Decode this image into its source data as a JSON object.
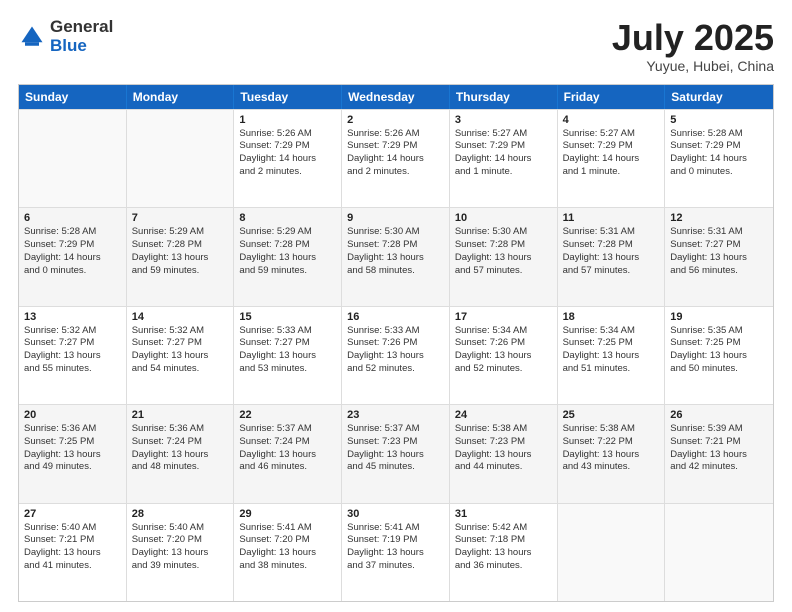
{
  "header": {
    "logo_general": "General",
    "logo_blue": "Blue",
    "month_title": "July 2025",
    "location": "Yuyue, Hubei, China"
  },
  "days_of_week": [
    "Sunday",
    "Monday",
    "Tuesday",
    "Wednesday",
    "Thursday",
    "Friday",
    "Saturday"
  ],
  "weeks": [
    [
      {
        "day": "",
        "info": [],
        "empty": true
      },
      {
        "day": "",
        "info": [],
        "empty": true
      },
      {
        "day": "1",
        "info": [
          "Sunrise: 5:26 AM",
          "Sunset: 7:29 PM",
          "Daylight: 14 hours",
          "and 2 minutes."
        ],
        "empty": false
      },
      {
        "day": "2",
        "info": [
          "Sunrise: 5:26 AM",
          "Sunset: 7:29 PM",
          "Daylight: 14 hours",
          "and 2 minutes."
        ],
        "empty": false
      },
      {
        "day": "3",
        "info": [
          "Sunrise: 5:27 AM",
          "Sunset: 7:29 PM",
          "Daylight: 14 hours",
          "and 1 minute."
        ],
        "empty": false
      },
      {
        "day": "4",
        "info": [
          "Sunrise: 5:27 AM",
          "Sunset: 7:29 PM",
          "Daylight: 14 hours",
          "and 1 minute."
        ],
        "empty": false
      },
      {
        "day": "5",
        "info": [
          "Sunrise: 5:28 AM",
          "Sunset: 7:29 PM",
          "Daylight: 14 hours",
          "and 0 minutes."
        ],
        "empty": false
      }
    ],
    [
      {
        "day": "6",
        "info": [
          "Sunrise: 5:28 AM",
          "Sunset: 7:29 PM",
          "Daylight: 14 hours",
          "and 0 minutes."
        ],
        "empty": false
      },
      {
        "day": "7",
        "info": [
          "Sunrise: 5:29 AM",
          "Sunset: 7:28 PM",
          "Daylight: 13 hours",
          "and 59 minutes."
        ],
        "empty": false
      },
      {
        "day": "8",
        "info": [
          "Sunrise: 5:29 AM",
          "Sunset: 7:28 PM",
          "Daylight: 13 hours",
          "and 59 minutes."
        ],
        "empty": false
      },
      {
        "day": "9",
        "info": [
          "Sunrise: 5:30 AM",
          "Sunset: 7:28 PM",
          "Daylight: 13 hours",
          "and 58 minutes."
        ],
        "empty": false
      },
      {
        "day": "10",
        "info": [
          "Sunrise: 5:30 AM",
          "Sunset: 7:28 PM",
          "Daylight: 13 hours",
          "and 57 minutes."
        ],
        "empty": false
      },
      {
        "day": "11",
        "info": [
          "Sunrise: 5:31 AM",
          "Sunset: 7:28 PM",
          "Daylight: 13 hours",
          "and 57 minutes."
        ],
        "empty": false
      },
      {
        "day": "12",
        "info": [
          "Sunrise: 5:31 AM",
          "Sunset: 7:27 PM",
          "Daylight: 13 hours",
          "and 56 minutes."
        ],
        "empty": false
      }
    ],
    [
      {
        "day": "13",
        "info": [
          "Sunrise: 5:32 AM",
          "Sunset: 7:27 PM",
          "Daylight: 13 hours",
          "and 55 minutes."
        ],
        "empty": false
      },
      {
        "day": "14",
        "info": [
          "Sunrise: 5:32 AM",
          "Sunset: 7:27 PM",
          "Daylight: 13 hours",
          "and 54 minutes."
        ],
        "empty": false
      },
      {
        "day": "15",
        "info": [
          "Sunrise: 5:33 AM",
          "Sunset: 7:27 PM",
          "Daylight: 13 hours",
          "and 53 minutes."
        ],
        "empty": false
      },
      {
        "day": "16",
        "info": [
          "Sunrise: 5:33 AM",
          "Sunset: 7:26 PM",
          "Daylight: 13 hours",
          "and 52 minutes."
        ],
        "empty": false
      },
      {
        "day": "17",
        "info": [
          "Sunrise: 5:34 AM",
          "Sunset: 7:26 PM",
          "Daylight: 13 hours",
          "and 52 minutes."
        ],
        "empty": false
      },
      {
        "day": "18",
        "info": [
          "Sunrise: 5:34 AM",
          "Sunset: 7:25 PM",
          "Daylight: 13 hours",
          "and 51 minutes."
        ],
        "empty": false
      },
      {
        "day": "19",
        "info": [
          "Sunrise: 5:35 AM",
          "Sunset: 7:25 PM",
          "Daylight: 13 hours",
          "and 50 minutes."
        ],
        "empty": false
      }
    ],
    [
      {
        "day": "20",
        "info": [
          "Sunrise: 5:36 AM",
          "Sunset: 7:25 PM",
          "Daylight: 13 hours",
          "and 49 minutes."
        ],
        "empty": false
      },
      {
        "day": "21",
        "info": [
          "Sunrise: 5:36 AM",
          "Sunset: 7:24 PM",
          "Daylight: 13 hours",
          "and 48 minutes."
        ],
        "empty": false
      },
      {
        "day": "22",
        "info": [
          "Sunrise: 5:37 AM",
          "Sunset: 7:24 PM",
          "Daylight: 13 hours",
          "and 46 minutes."
        ],
        "empty": false
      },
      {
        "day": "23",
        "info": [
          "Sunrise: 5:37 AM",
          "Sunset: 7:23 PM",
          "Daylight: 13 hours",
          "and 45 minutes."
        ],
        "empty": false
      },
      {
        "day": "24",
        "info": [
          "Sunrise: 5:38 AM",
          "Sunset: 7:23 PM",
          "Daylight: 13 hours",
          "and 44 minutes."
        ],
        "empty": false
      },
      {
        "day": "25",
        "info": [
          "Sunrise: 5:38 AM",
          "Sunset: 7:22 PM",
          "Daylight: 13 hours",
          "and 43 minutes."
        ],
        "empty": false
      },
      {
        "day": "26",
        "info": [
          "Sunrise: 5:39 AM",
          "Sunset: 7:21 PM",
          "Daylight: 13 hours",
          "and 42 minutes."
        ],
        "empty": false
      }
    ],
    [
      {
        "day": "27",
        "info": [
          "Sunrise: 5:40 AM",
          "Sunset: 7:21 PM",
          "Daylight: 13 hours",
          "and 41 minutes."
        ],
        "empty": false
      },
      {
        "day": "28",
        "info": [
          "Sunrise: 5:40 AM",
          "Sunset: 7:20 PM",
          "Daylight: 13 hours",
          "and 39 minutes."
        ],
        "empty": false
      },
      {
        "day": "29",
        "info": [
          "Sunrise: 5:41 AM",
          "Sunset: 7:20 PM",
          "Daylight: 13 hours",
          "and 38 minutes."
        ],
        "empty": false
      },
      {
        "day": "30",
        "info": [
          "Sunrise: 5:41 AM",
          "Sunset: 7:19 PM",
          "Daylight: 13 hours",
          "and 37 minutes."
        ],
        "empty": false
      },
      {
        "day": "31",
        "info": [
          "Sunrise: 5:42 AM",
          "Sunset: 7:18 PM",
          "Daylight: 13 hours",
          "and 36 minutes."
        ],
        "empty": false
      },
      {
        "day": "",
        "info": [],
        "empty": true
      },
      {
        "day": "",
        "info": [],
        "empty": true
      }
    ]
  ]
}
